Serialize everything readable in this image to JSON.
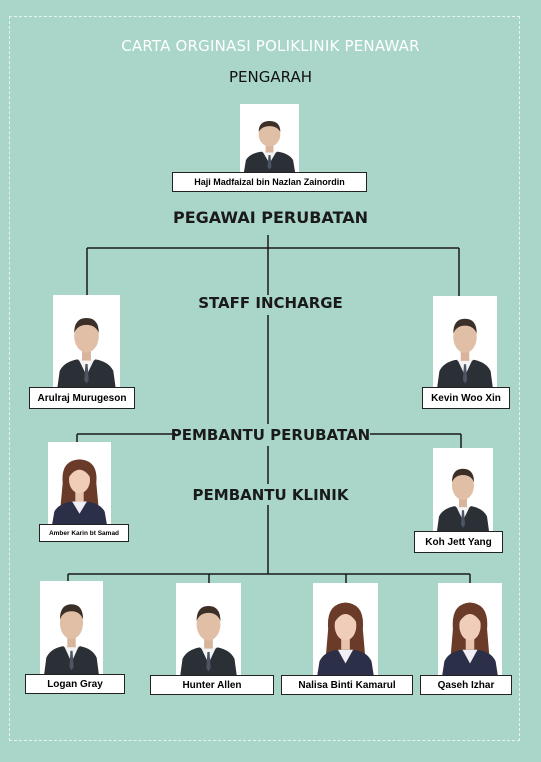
{
  "title": "CARTA ORGINASI POLIKLINIK PENAWAR",
  "sections": {
    "pengarah": "PENGARAH",
    "pegawai": "PEGAWAI PERUBATAN",
    "staff": "STAFF INCHARGE",
    "pembantu_perubatan": "PEMBANTU PERUBATAN",
    "pembantu_klinik": "PEMBANTU KLINIK"
  },
  "people": {
    "director": "Haji Madfaizal bin Nazlan Zainordin",
    "officer_left": "Arulraj Murugeson",
    "officer_right": "Kevin Woo Xin",
    "mid_left": "Amber Karin bt Samad",
    "mid_right": "Koh Jett Yang",
    "clinic_1": "Logan Gray",
    "clinic_2": "Hunter Allen",
    "clinic_3": "Nalisa Binti Kamarul",
    "clinic_4": "Qaseh Izhar"
  },
  "colors": {
    "background": "#a9d6c9",
    "suit": "#2b2f36",
    "line": "#1a1a1a"
  }
}
